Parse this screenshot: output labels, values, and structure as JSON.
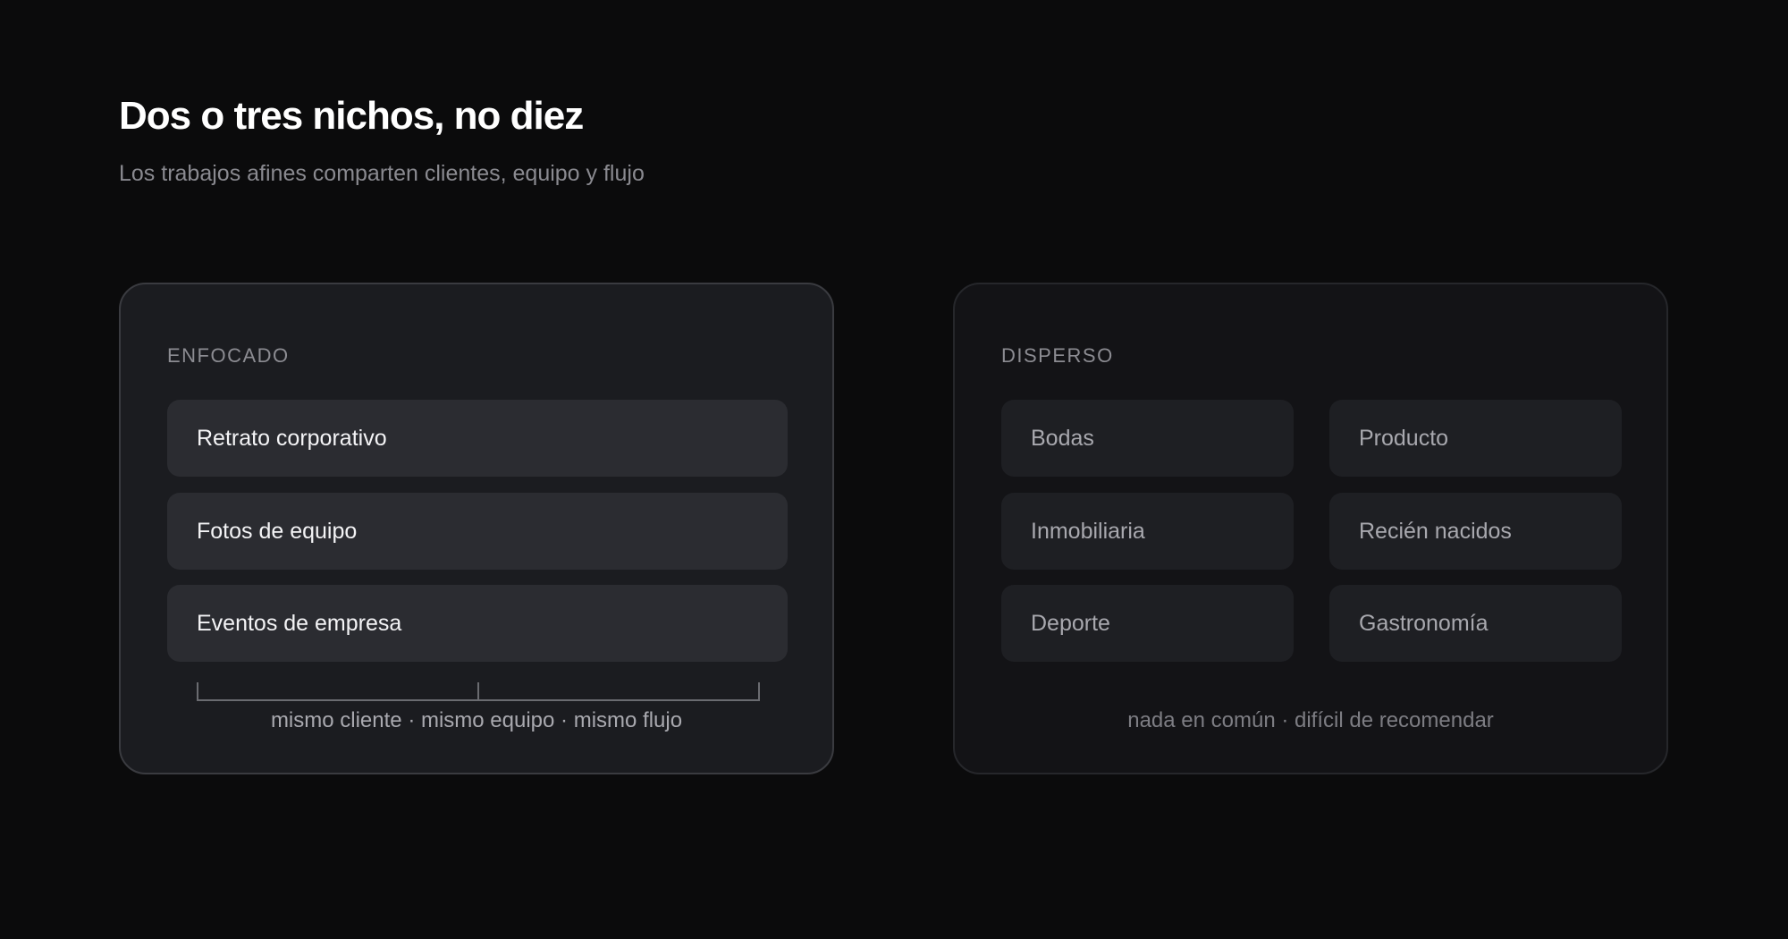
{
  "header": {
    "title": "Dos o tres nichos, no diez",
    "subtitle": "Los trabajos afines comparten clientes, equipo y flujo"
  },
  "focused": {
    "label": "ENFOCADO",
    "items": [
      "Retrato corporativo",
      "Fotos de equipo",
      "Eventos de empresa"
    ],
    "footer": "mismo cliente · mismo equipo · mismo flujo"
  },
  "scattered": {
    "label": "DISPERSO",
    "items": [
      "Bodas",
      "Producto",
      "Inmobiliaria",
      "Recién nacidos",
      "Deporte",
      "Gastronomía"
    ],
    "footer": "nada en común · difícil de recomendar"
  },
  "colors": {
    "background": "#0b0b0c",
    "focused_card": "#1b1c20",
    "scattered_card": "#131316",
    "connector": "#6a6b70"
  }
}
